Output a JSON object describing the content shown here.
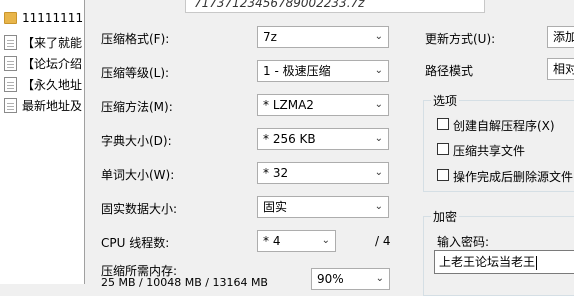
{
  "explorer": {
    "items": [
      {
        "icon": "folder-icon",
        "label": "11111111"
      },
      {
        "icon": "text-file-icon",
        "label": "【来了就能"
      },
      {
        "icon": "text-file-icon",
        "label": "【论坛介绍"
      },
      {
        "icon": "text-file-icon",
        "label": "【永久地址"
      },
      {
        "icon": "text-file-icon",
        "label": "最新地址及"
      }
    ]
  },
  "dialog": {
    "archive_path": "717371234567890022​33.7z",
    "format": {
      "label": "压缩格式(F):",
      "value": "7z"
    },
    "level": {
      "label": "压缩等级(L):",
      "value": "1 - 极速压缩"
    },
    "method": {
      "label": "压缩方法(M):",
      "value": "* LZMA2"
    },
    "dict": {
      "label": "字典大小(D):",
      "value": "* 256 KB"
    },
    "word": {
      "label": "单词大小(W):",
      "value": "* 32"
    },
    "solid": {
      "label": "固实数据大小:",
      "value": "固实"
    },
    "cpu": {
      "label": "CPU 线程数:",
      "value": "* 4",
      "max": "/ 4"
    },
    "memory": {
      "label": "压缩所需内存:",
      "value": "25 MB / 10048 MB / 13164 MB",
      "percent": "90%"
    },
    "update": {
      "label": "更新方式(U):",
      "value": "添加"
    },
    "path_mode": {
      "label": "路径模式",
      "value": "相对"
    },
    "options": {
      "title": "选项",
      "sfx": "创建自解压程序(X)",
      "shared": "压缩共享文件",
      "delete": "操作完成后删除源文件"
    },
    "encryption": {
      "title": "加密",
      "password_label": "输入密码:",
      "password_value": "上老王论坛当老王"
    }
  }
}
